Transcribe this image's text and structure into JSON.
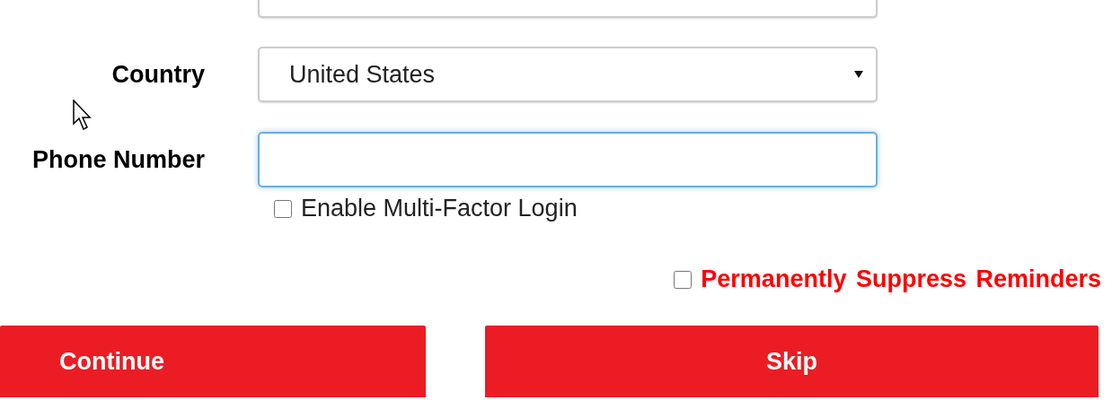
{
  "form": {
    "fields": [
      {
        "kind": "select",
        "label": "Country",
        "value": "United States",
        "focused": false
      },
      {
        "kind": "input",
        "label": "Phone Number",
        "focused": true
      }
    ],
    "mfa_option": {
      "label": "Enable Multi-Factor Login",
      "checked": false
    }
  },
  "suppress_option": {
    "label": "Permanently Suppress Reminders",
    "checked": false
  },
  "buttons": [
    {
      "label": "Continue",
      "kind": "continue"
    },
    {
      "label": "Skip",
      "kind": "skip"
    }
  ]
}
